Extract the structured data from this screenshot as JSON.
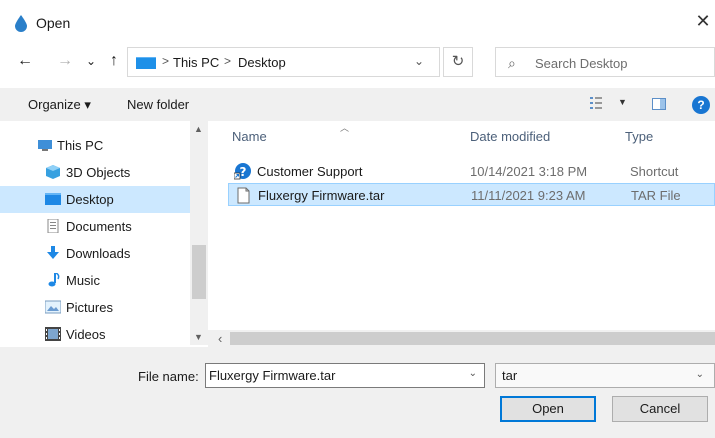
{
  "window": {
    "title": "Open",
    "close": "✕"
  },
  "nav": {
    "back": "←",
    "forward": "→",
    "recent": "⌄",
    "up": "↑",
    "address_segments": [
      "This PC",
      "Desktop"
    ],
    "address_separator": ">",
    "refresh": "↻",
    "search_placeholder": "Search Desktop"
  },
  "toolbar": {
    "organize": "Organize ▾",
    "new_folder": "New folder",
    "view_dropdown": "▼",
    "help": "?"
  },
  "sidebar": {
    "items": [
      {
        "label": "This PC",
        "icon": "computer-icon"
      },
      {
        "label": "3D Objects",
        "icon": "cube-icon"
      },
      {
        "label": "Desktop",
        "icon": "desktop-icon",
        "selected": true
      },
      {
        "label": "Documents",
        "icon": "document-icon"
      },
      {
        "label": "Downloads",
        "icon": "download-icon"
      },
      {
        "label": "Music",
        "icon": "music-icon"
      },
      {
        "label": "Pictures",
        "icon": "picture-icon"
      },
      {
        "label": "Videos",
        "icon": "video-icon"
      }
    ]
  },
  "files": {
    "columns": {
      "name": "Name",
      "date": "Date modified",
      "type": "Type"
    },
    "rows": [
      {
        "name": "Customer Support",
        "date": "10/14/2021 3:18 PM",
        "type": "Shortcut",
        "icon": "help-shortcut-icon"
      },
      {
        "name": "Fluxergy Firmware.tar",
        "date": "11/11/2021 9:23 AM",
        "type": "TAR File",
        "icon": "file-icon",
        "selected": true
      }
    ]
  },
  "bottom": {
    "file_name_label": "File name:",
    "file_name_value": "Fluxergy Firmware.tar",
    "file_type_value": "tar",
    "open_button": "Open",
    "cancel_button": "Cancel"
  },
  "colors": {
    "selection": "#cce8ff",
    "accent": "#0078d7",
    "chrome": "#f0f0f0"
  }
}
